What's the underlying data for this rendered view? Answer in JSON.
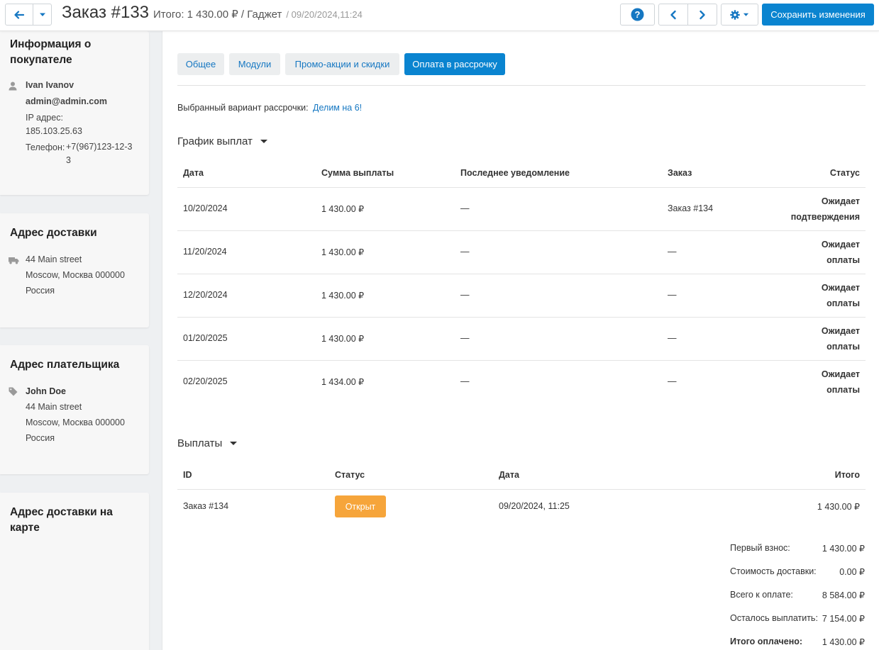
{
  "header": {
    "title": "Заказ #133",
    "total": "Итого: 1 430.00 ₽ / Гаджет",
    "datetime": "/ 09/20/2024,11:24",
    "save_label": "Сохранить изменения",
    "help_label": "?"
  },
  "sidebar": {
    "buyer": {
      "heading": "Информация о покупателе",
      "name": "Ivan Ivanov",
      "email": "admin@admin.com",
      "ip_label": "IP адрес:",
      "ip": "185.103.25.63",
      "phone_label": "Телефон:",
      "phone": "+7(967)123-12-33"
    },
    "shipping": {
      "heading": "Адрес доставки",
      "line1": "44 Main street",
      "line2": "Moscow, Москва 000000",
      "line3": "Россия"
    },
    "billing": {
      "heading": "Адрес плательщика",
      "name": "John Doe",
      "line1": "44 Main street",
      "line2": "Moscow, Москва 000000",
      "line3": "Россия"
    },
    "map": {
      "heading": "Адрес доставки на карте"
    }
  },
  "tabs": [
    "Общее",
    "Модули",
    "Промо-акции и скидки",
    "Оплата в рассрочку"
  ],
  "installment": {
    "variant_label": "Выбранный вариант рассрочки:",
    "variant_value": "Делим на 6!"
  },
  "schedule": {
    "title": "График выплат",
    "columns": [
      "Дата",
      "Сумма выплаты",
      "Последнее уведомление",
      "Заказ",
      "Статус"
    ],
    "rows": [
      {
        "date": "10/20/2024",
        "amount": "1 430.00 ₽",
        "notice": "—",
        "order": "Заказ #134",
        "status1": "Ожидает",
        "status2": "подтверждения"
      },
      {
        "date": "11/20/2024",
        "amount": "1 430.00 ₽",
        "notice": "—",
        "order": "—",
        "status1": "Ожидает",
        "status2": "оплаты"
      },
      {
        "date": "12/20/2024",
        "amount": "1 430.00 ₽",
        "notice": "—",
        "order": "—",
        "status1": "Ожидает",
        "status2": "оплаты"
      },
      {
        "date": "01/20/2025",
        "amount": "1 430.00 ₽",
        "notice": "—",
        "order": "—",
        "status1": "Ожидает",
        "status2": "оплаты"
      },
      {
        "date": "02/20/2025",
        "amount": "1 434.00 ₽",
        "notice": "—",
        "order": "—",
        "status1": "Ожидает",
        "status2": "оплаты"
      }
    ]
  },
  "payments": {
    "title": "Выплаты",
    "columns": [
      "ID",
      "Статус",
      "Дата",
      "Итого"
    ],
    "rows": [
      {
        "id": "Заказ #134",
        "status": "Открыт",
        "date": "09/20/2024, 11:25",
        "total": "1 430.00 ₽"
      }
    ]
  },
  "summary": [
    {
      "label": "Первый взнос:",
      "value": "1 430.00 ₽"
    },
    {
      "label": "Стоимость доставки:",
      "value": "0.00 ₽"
    },
    {
      "label": "Всего к оплате:",
      "value": "8 584.00 ₽"
    },
    {
      "label": "Осталось выплатить:",
      "value": "7 154.00 ₽"
    },
    {
      "label": "Итого оплачено:",
      "value": "1 430.00 ₽"
    }
  ],
  "colors": {
    "accent": "#0a84d0",
    "link": "#1577c2",
    "badge_open": "#f6a53b"
  }
}
